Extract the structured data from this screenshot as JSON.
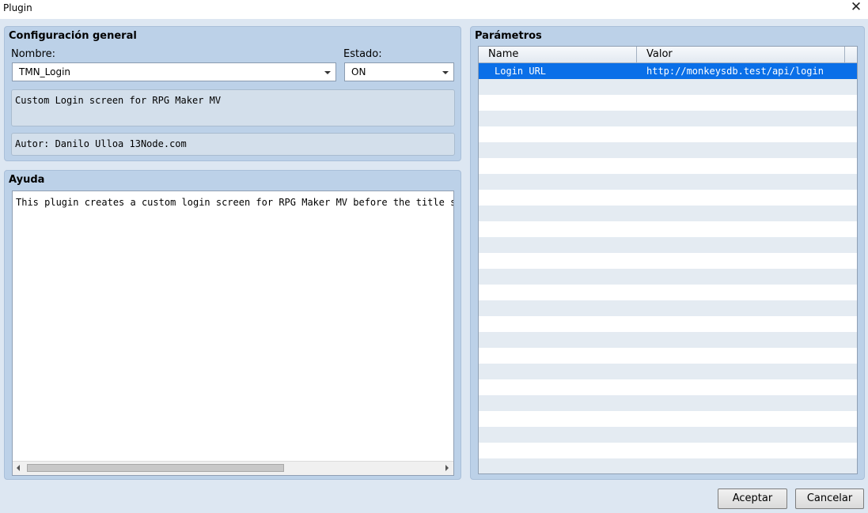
{
  "window": {
    "title": "Plugin"
  },
  "general": {
    "title": "Configuración general",
    "name_label": "Nombre:",
    "name_value": "TMN_Login",
    "status_label": "Estado:",
    "status_value": "ON",
    "description": "Custom Login screen for RPG Maker MV",
    "author": "Autor: Danilo Ulloa 13Node.com"
  },
  "help": {
    "title": "Ayuda",
    "text": "This plugin creates a custom login screen for RPG Maker MV before the title screen"
  },
  "params": {
    "title": "Parámetros",
    "columns": {
      "name": "Name",
      "value": "Valor"
    },
    "rows": [
      {
        "name": "Login URL",
        "value": "http://monkeysdb.test/api/login"
      }
    ]
  },
  "buttons": {
    "ok": "Aceptar",
    "cancel": "Cancelar"
  },
  "icons": {
    "close": "close-icon",
    "dropdown": "chevron-down-icon"
  },
  "colors": {
    "selection": "#0a6fe8",
    "panel": "#bcd1e8",
    "background": "#dde7f2"
  }
}
